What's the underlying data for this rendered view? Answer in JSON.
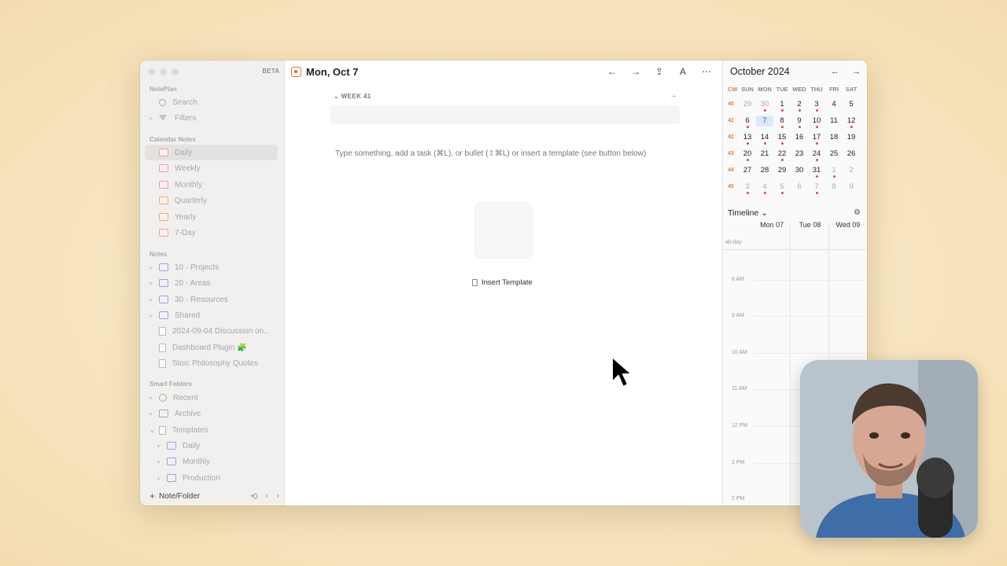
{
  "colors": {
    "background": "#f8e7c4",
    "accent_orange": "#e07a2f",
    "today_highlight": "#dbe9fb",
    "dot_red": "#d94a4a"
  },
  "sidebar": {
    "beta_label": "BETA",
    "section_notepl": "NotePlan",
    "search_label": "Search",
    "filters_label": "Filters",
    "section_calendar": "Calendar Notes",
    "calendar_items": [
      "Daily",
      "Weekly",
      "Monthly",
      "Quarterly",
      "Yearly",
      "7-Day"
    ],
    "section_notes": "Notes",
    "notes_items": [
      "10 - Projects",
      "20 - Areas",
      "30 - Resources",
      "Shared",
      "2024-09-04 Discussion on...",
      "Dashboard Plugin 🧩",
      "Stoic Philosophy Quotes"
    ],
    "section_smart": "Smart Folders",
    "smart_items": [
      "Recent",
      "Archive",
      "Templates"
    ],
    "template_children": [
      "Daily",
      "Monthly",
      "Production"
    ],
    "add_label": "Note/Folder"
  },
  "main": {
    "date_title": "Mon, Oct 7",
    "week_label": "WEEK 41",
    "hint": "Type something, add a task (⌘L), or bullet (⇧⌘L) or insert a template (see button below)",
    "insert_template": "Insert Template",
    "toolbar_icons": [
      "arrow-left-icon",
      "arrow-right-icon",
      "share-icon",
      "font-icon",
      "more-icon"
    ]
  },
  "calendar": {
    "month_title": "October 2024",
    "headers": [
      "CW",
      "SUN",
      "MON",
      "TUE",
      "WED",
      "THU",
      "FRI",
      "SAT"
    ],
    "weeks": [
      {
        "cw": "40",
        "days": [
          {
            "d": "29",
            "dim": true
          },
          {
            "d": "30",
            "dim": true,
            "dot": true
          },
          {
            "d": "1",
            "dot": true
          },
          {
            "d": "2",
            "dot": true
          },
          {
            "d": "3",
            "dot": true
          },
          {
            "d": "4"
          },
          {
            "d": "5"
          }
        ]
      },
      {
        "cw": "41",
        "days": [
          {
            "d": "6",
            "dot": true
          },
          {
            "d": "7",
            "today": true
          },
          {
            "d": "8",
            "dot": true
          },
          {
            "d": "9",
            "dot": true
          },
          {
            "d": "10",
            "dot": true
          },
          {
            "d": "11"
          },
          {
            "d": "12",
            "dot": true
          }
        ]
      },
      {
        "cw": "42",
        "days": [
          {
            "d": "13",
            "dot": true
          },
          {
            "d": "14",
            "dot": true
          },
          {
            "d": "15",
            "dot": true
          },
          {
            "d": "16"
          },
          {
            "d": "17",
            "dot": true
          },
          {
            "d": "18"
          },
          {
            "d": "19"
          }
        ]
      },
      {
        "cw": "43",
        "days": [
          {
            "d": "20",
            "dot": true
          },
          {
            "d": "21"
          },
          {
            "d": "22",
            "dot": true
          },
          {
            "d": "23"
          },
          {
            "d": "24",
            "dot": true
          },
          {
            "d": "25"
          },
          {
            "d": "26"
          }
        ]
      },
      {
        "cw": "44",
        "days": [
          {
            "d": "27"
          },
          {
            "d": "28"
          },
          {
            "d": "29"
          },
          {
            "d": "30"
          },
          {
            "d": "31",
            "dot": true
          },
          {
            "d": "1",
            "dim": true,
            "dot": true
          },
          {
            "d": "2",
            "dim": true
          }
        ]
      },
      {
        "cw": "45",
        "days": [
          {
            "d": "3",
            "dim": true,
            "dot": true
          },
          {
            "d": "4",
            "dim": true,
            "dot": true
          },
          {
            "d": "5",
            "dim": true,
            "dot": true
          },
          {
            "d": "6",
            "dim": true
          },
          {
            "d": "7",
            "dim": true,
            "dot": true
          },
          {
            "d": "8",
            "dim": true
          },
          {
            "d": "9",
            "dim": true
          }
        ]
      }
    ]
  },
  "timeline": {
    "title": "Timeline",
    "days": [
      "Mon 07",
      "Tue 08",
      "Wed 09"
    ],
    "allday": "all-day",
    "hours": [
      "8 AM",
      "9 AM",
      "10 AM",
      "11 AM",
      "12 PM",
      "1 PM",
      "2 PM"
    ]
  }
}
